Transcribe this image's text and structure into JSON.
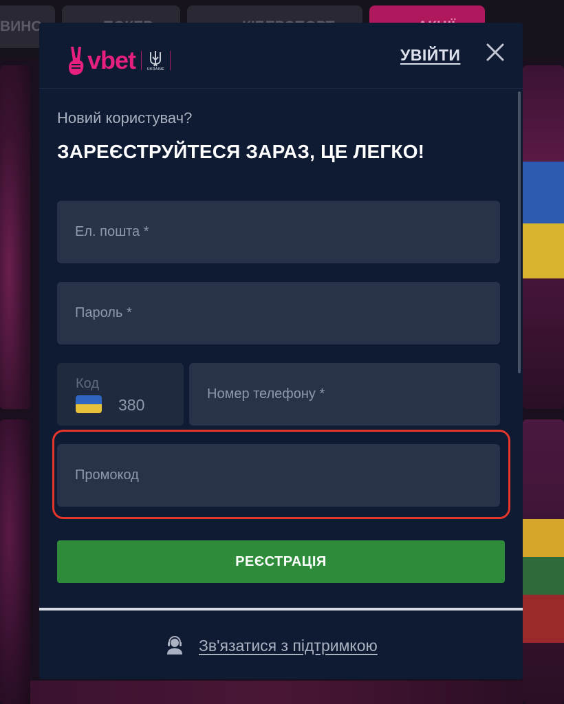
{
  "background": {
    "tabs": [
      {
        "label": "ВИНО"
      },
      {
        "label": "ПОКЕР"
      },
      {
        "label": "КІБЕРСПОРТ"
      },
      {
        "label": "АКЦІЇ"
      }
    ]
  },
  "modal": {
    "logo_text": "vbet",
    "logo_sub": "UKRAINE",
    "login_label": "УВІЙТИ",
    "subtitle": "Новий користувач?",
    "headline": "ЗАРЕЄСТРУЙТЕСЯ ЗАРАЗ, ЦЕ ЛЕГКО!",
    "fields": {
      "email_placeholder": "Ел. пошта *",
      "password_placeholder": "Пароль *",
      "code_label": "Код",
      "code_value": "380",
      "phone_placeholder": "Номер телефону *",
      "promo_placeholder": "Промокод"
    },
    "register_label": "РЕЄСТРАЦІЯ",
    "support_label": "Зв'язатися з підтримкою"
  },
  "colors": {
    "brand_pink": "#e5207f",
    "modal_bg": "#0f1a33",
    "field_bg": "#283349",
    "register_green": "#2e8b3a",
    "highlight_red": "#e4362a"
  }
}
